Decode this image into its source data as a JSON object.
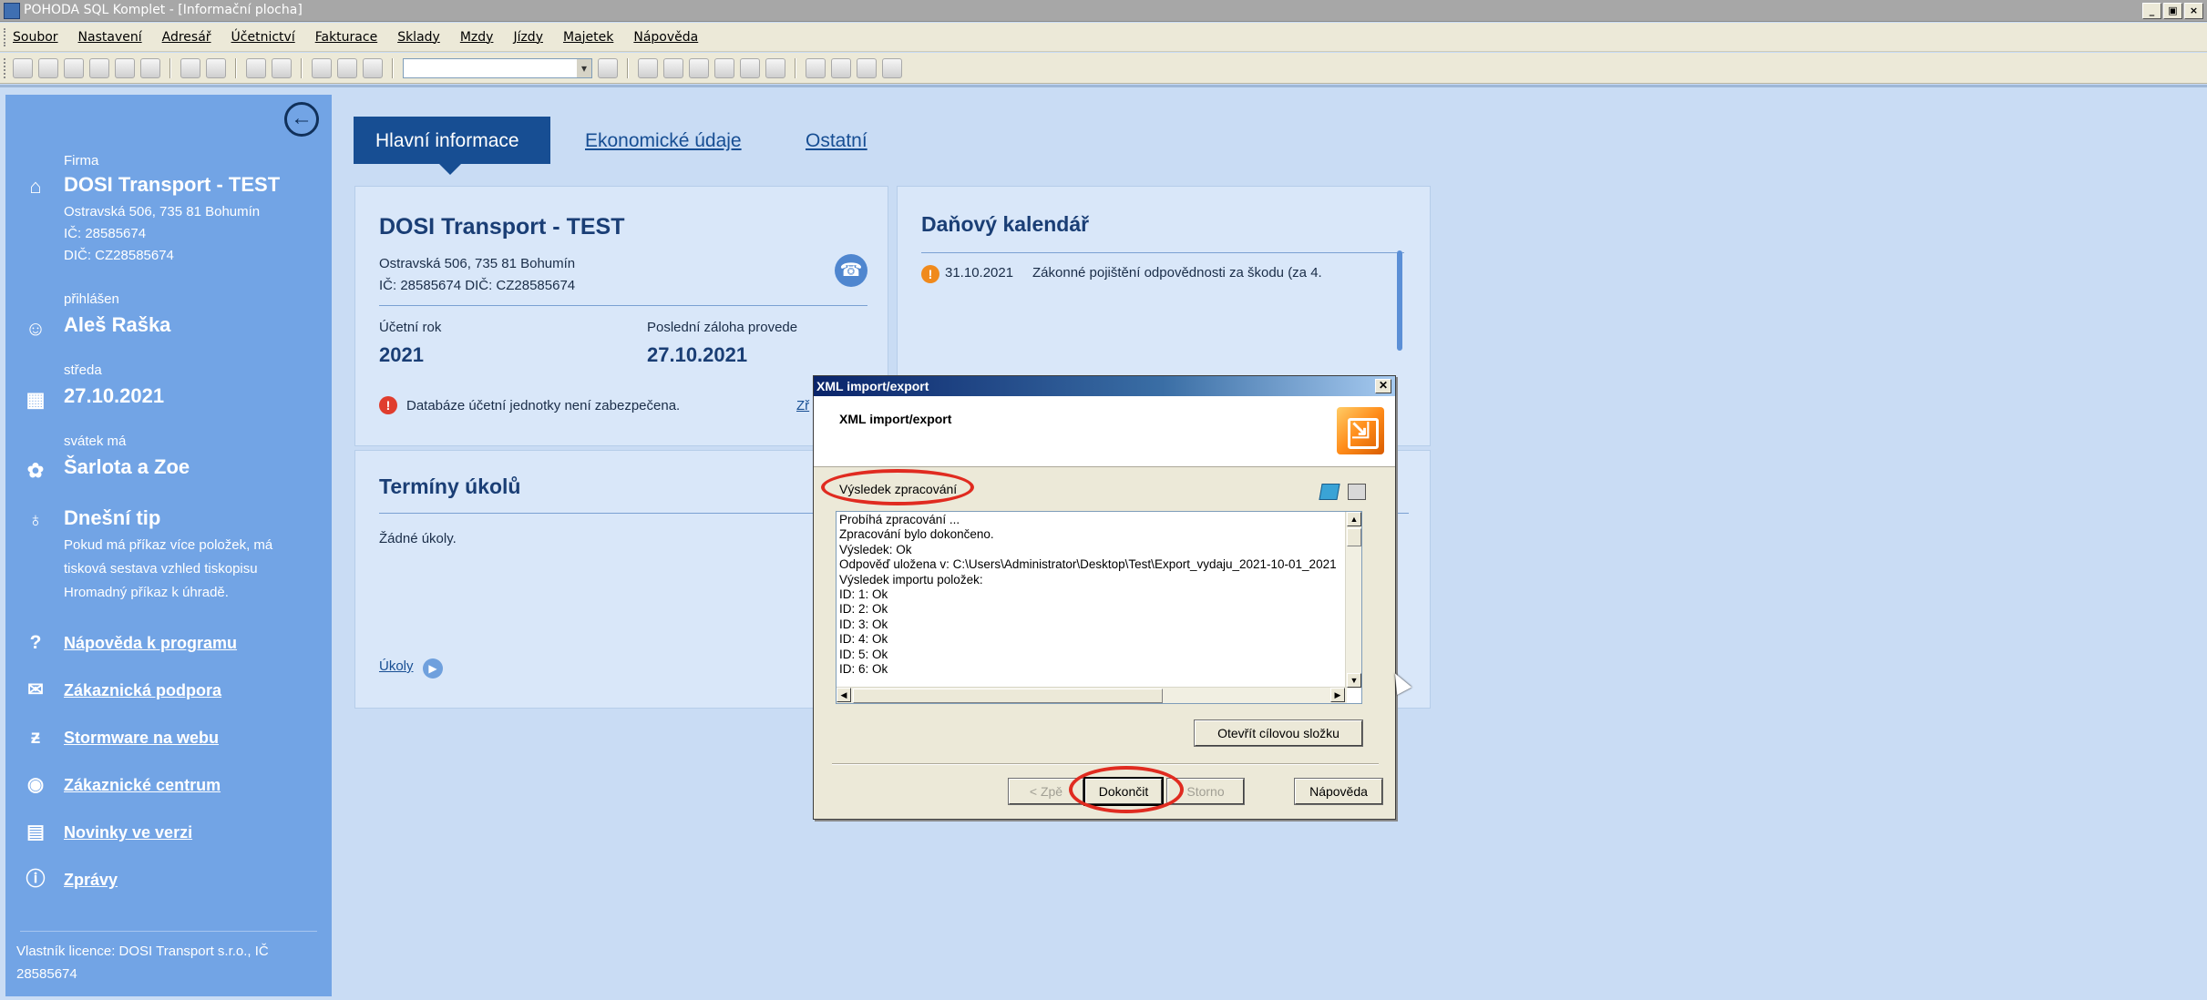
{
  "window": {
    "title": "POHODA SQL Komplet - [Informační plocha]",
    "buttons": [
      "_",
      "▣",
      "×"
    ]
  },
  "menu": [
    "Soubor",
    "Nastavení",
    "Adresář",
    "Účetnictví",
    "Fakturace",
    "Sklady",
    "Mzdy",
    "Jízdy",
    "Majetek",
    "Nápověda"
  ],
  "sidebar": {
    "firma_label": "Firma",
    "firma_name": "DOSI Transport - TEST",
    "firma_address": "Ostravská 506, 735 81 Bohumín",
    "firma_ic": "IČ: 28585674",
    "firma_dic": "DIČ: CZ28585674",
    "user_label": "přihlášen",
    "user_name": "Aleš Raška",
    "day_label": "středa",
    "date": "27.10.2021",
    "svatek_label": "svátek má",
    "svatek_name": "Šarlota a Zoe",
    "tip_title": "Dnešní tip",
    "tip_lines": [
      "Pokud má příkaz více položek, má",
      "tisková sestava vzhled tiskopisu",
      "Hromadný příkaz k úhradě."
    ],
    "links": [
      "Nápověda k programu",
      "Zákaznická podpora",
      "Stormware na webu",
      "Zákaznické centrum",
      "Novinky ve verzi",
      "Zprávy"
    ],
    "owner": "Vlastník licence: DOSI Transport s.r.o., IČ 28585674"
  },
  "tabs": [
    "Hlavní informace",
    "Ekonomické údaje",
    "Ostatní"
  ],
  "company_panel": {
    "title": "DOSI Transport - TEST",
    "address": "Ostravská 506, 735 81 Bohumín",
    "ids": "IČ: 28585674  DIČ: CZ28585674",
    "year_label": "Účetní rok",
    "year": "2021",
    "backup_label": "Poslední záloha provede",
    "backup_date": "27.10.2021",
    "warning": "Databáze účetní jednotky není zabezpečena.",
    "warning_link": "Zř"
  },
  "calendar_panel": {
    "title": "Daňový kalendář",
    "date": "31.10.2021",
    "text": "Zákonné pojištění odpovědnosti za škodu (za 4."
  },
  "tasks_panel": {
    "title": "Termíny úkolů",
    "empty": "Žádné úkoly.",
    "link": "Úkoly"
  },
  "dialog": {
    "title": "XML import/export",
    "header": "XML import/export",
    "result_label": "Výsledek zpracování",
    "log": [
      "Probíhá zpracování ...",
      "Zpracování bylo dokončeno.",
      "Výsledek: Ok",
      "Odpověď uložena v: C:\\Users\\Administrator\\Desktop\\Test\\Export_vydaju_2021-10-01_2021",
      "Výsledek importu položek:",
      "ID: 1: Ok",
      "ID: 2: Ok",
      "ID: 3: Ok",
      "ID: 4: Ok",
      "ID: 5: Ok",
      "ID: 6: Ok"
    ],
    "open_folder": "Otevřít cílovou složku",
    "back": "< Zpě",
    "finish": "Dokončit",
    "cancel": "Storno",
    "help": "Nápověda"
  }
}
